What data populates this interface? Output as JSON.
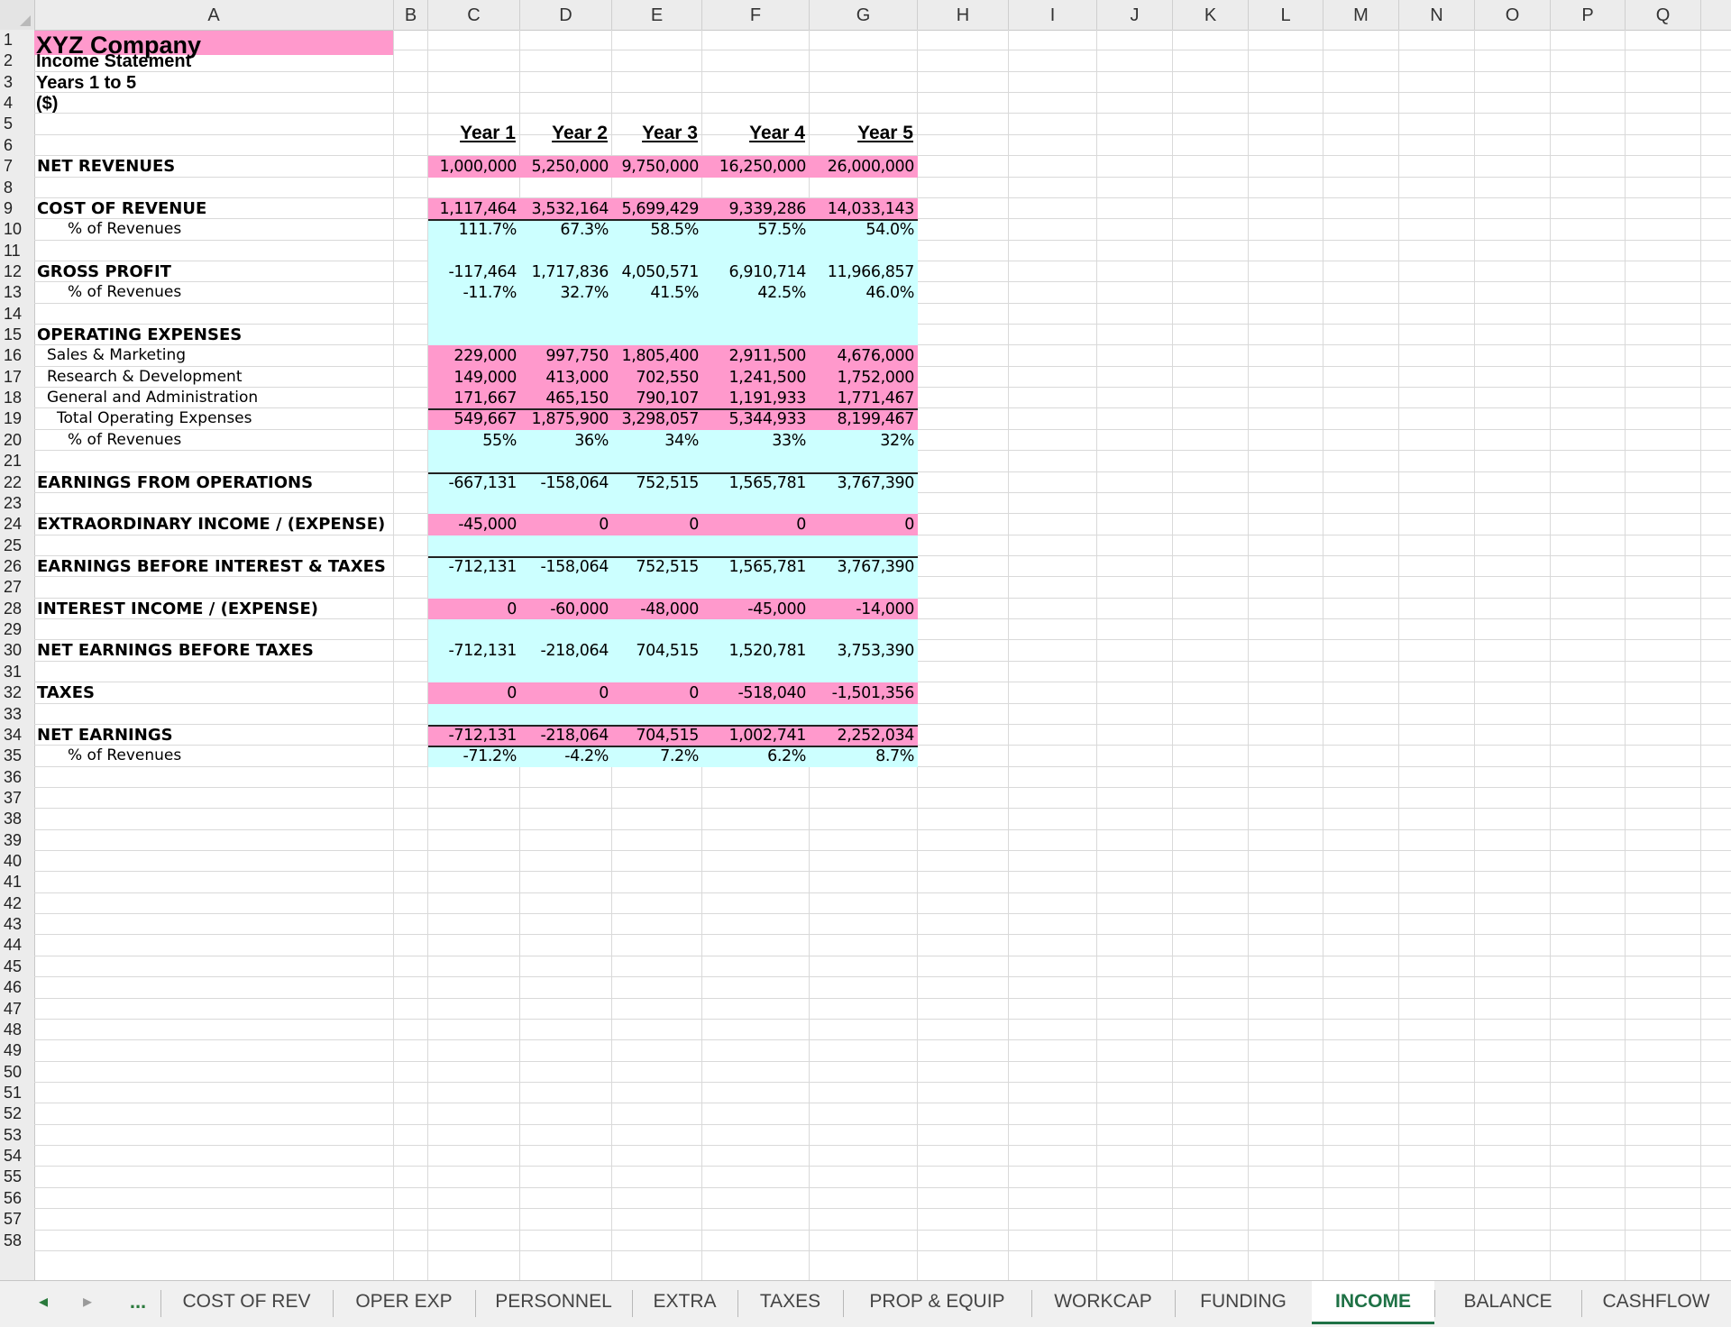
{
  "columns": [
    "A",
    "B",
    "C",
    "D",
    "E",
    "F",
    "G",
    "H",
    "I",
    "J",
    "K",
    "L",
    "M",
    "N",
    "O",
    "P",
    "Q"
  ],
  "rows": [
    "1",
    "2",
    "3",
    "4",
    "5",
    "6",
    "7",
    "8",
    "9",
    "10",
    "11",
    "12",
    "13",
    "14",
    "15",
    "16",
    "17",
    "18",
    "19",
    "20",
    "21",
    "22",
    "23",
    "24",
    "25",
    "26",
    "27",
    "28",
    "29",
    "30",
    "31",
    "32",
    "33",
    "34",
    "35",
    "36",
    "37",
    "38",
    "39",
    "40",
    "41",
    "42",
    "43",
    "44",
    "45",
    "46",
    "47",
    "48",
    "49",
    "50",
    "51",
    "52",
    "53",
    "54",
    "55",
    "56",
    "57",
    "58"
  ],
  "header": {
    "company": "XYZ Company",
    "statement": "Income Statement",
    "period": "Years 1 to 5",
    "unit": "($)"
  },
  "years": [
    "Year 1",
    "Year 2",
    "Year 3",
    "Year 4",
    "Year 5"
  ],
  "lines": [
    {
      "row": 7,
      "label": "NET REVENUES",
      "style": "bold",
      "fill": "pink",
      "values": [
        "1,000,000",
        "5,250,000",
        "9,750,000",
        "16,250,000",
        "26,000,000"
      ]
    },
    {
      "row": 9,
      "label": "COST OF REVENUE",
      "style": "bold",
      "fill": "pink",
      "values": [
        "1,117,464",
        "3,532,164",
        "5,699,429",
        "9,339,286",
        "14,033,143"
      ]
    },
    {
      "row": 10,
      "label": "% of Revenues",
      "style": "pct",
      "fill": "cyan",
      "values": [
        "111.7%",
        "67.3%",
        "58.5%",
        "57.5%",
        "54.0%"
      ]
    },
    {
      "row": 12,
      "label": "GROSS PROFIT",
      "style": "bold",
      "fill": "cyan",
      "values": [
        "-117,464",
        "1,717,836",
        "4,050,571",
        "6,910,714",
        "11,966,857"
      ]
    },
    {
      "row": 13,
      "label": "% of Revenues",
      "style": "pct",
      "fill": "cyan",
      "values": [
        "-11.7%",
        "32.7%",
        "41.5%",
        "42.5%",
        "46.0%"
      ]
    },
    {
      "row": 15,
      "label": "OPERATING EXPENSES",
      "style": "bold",
      "fill": "none",
      "values": []
    },
    {
      "row": 16,
      "label": "Sales & Marketing",
      "style": "item",
      "fill": "pink",
      "values": [
        "229,000",
        "997,750",
        "1,805,400",
        "2,911,500",
        "4,676,000"
      ]
    },
    {
      "row": 17,
      "label": "Research & Development",
      "style": "item",
      "fill": "pink",
      "values": [
        "149,000",
        "413,000",
        "702,550",
        "1,241,500",
        "1,752,000"
      ]
    },
    {
      "row": 18,
      "label": "General and Administration",
      "style": "item",
      "fill": "pink",
      "values": [
        "171,667",
        "465,150",
        "790,107",
        "1,191,933",
        "1,771,467"
      ]
    },
    {
      "row": 19,
      "label": "Total Operating Expenses",
      "style": "total",
      "fill": "pink",
      "values": [
        "549,667",
        "1,875,900",
        "3,298,057",
        "5,344,933",
        "8,199,467"
      ]
    },
    {
      "row": 20,
      "label": "% of Revenues",
      "style": "pct",
      "fill": "cyan",
      "values": [
        "55%",
        "36%",
        "34%",
        "33%",
        "32%"
      ]
    },
    {
      "row": 22,
      "label": "EARNINGS FROM OPERATIONS",
      "style": "bold",
      "fill": "cyan",
      "values": [
        "-667,131",
        "-158,064",
        "752,515",
        "1,565,781",
        "3,767,390"
      ]
    },
    {
      "row": 24,
      "label": "EXTRAORDINARY INCOME / (EXPENSE)",
      "style": "bold",
      "fill": "pink",
      "values": [
        "-45,000",
        "0",
        "0",
        "0",
        "0"
      ]
    },
    {
      "row": 26,
      "label": "EARNINGS BEFORE INTEREST & TAXES",
      "style": "bold",
      "fill": "cyan",
      "values": [
        "-712,131",
        "-158,064",
        "752,515",
        "1,565,781",
        "3,767,390"
      ]
    },
    {
      "row": 28,
      "label": "INTEREST INCOME / (EXPENSE)",
      "style": "bold",
      "fill": "pink",
      "values": [
        "0",
        "-60,000",
        "-48,000",
        "-45,000",
        "-14,000"
      ]
    },
    {
      "row": 30,
      "label": "NET EARNINGS BEFORE TAXES",
      "style": "bold",
      "fill": "cyan",
      "values": [
        "-712,131",
        "-218,064",
        "704,515",
        "1,520,781",
        "3,753,390"
      ]
    },
    {
      "row": 32,
      "label": "TAXES",
      "style": "bold",
      "fill": "pink",
      "values": [
        "0",
        "0",
        "0",
        "-518,040",
        "-1,501,356"
      ]
    },
    {
      "row": 34,
      "label": "NET EARNINGS",
      "style": "bold",
      "fill": "pink",
      "values": [
        "-712,131",
        "-218,064",
        "704,515",
        "1,002,741",
        "2,252,034"
      ]
    },
    {
      "row": 35,
      "label": "% of Revenues",
      "style": "pct",
      "fill": "cyan",
      "values": [
        "-71.2%",
        "-4.2%",
        "7.2%",
        "6.2%",
        "8.7%"
      ]
    }
  ],
  "colors": {
    "pink": "#ff99cc",
    "cyan": "#ccffff",
    "header_bg": "#ececec",
    "grid": "#d9d9d9",
    "active_tab": "#1e7145"
  },
  "tabs": {
    "nav_prev": "◂",
    "nav_next": "▸",
    "more": "...",
    "items": [
      "COST OF REV",
      "OPER EXP",
      "PERSONNEL",
      "EXTRA",
      "TAXES",
      "PROP & EQUIP",
      "WORKCAP",
      "FUNDING",
      "INCOME",
      "BALANCE",
      "CASHFLOW"
    ],
    "active": "INCOME"
  }
}
